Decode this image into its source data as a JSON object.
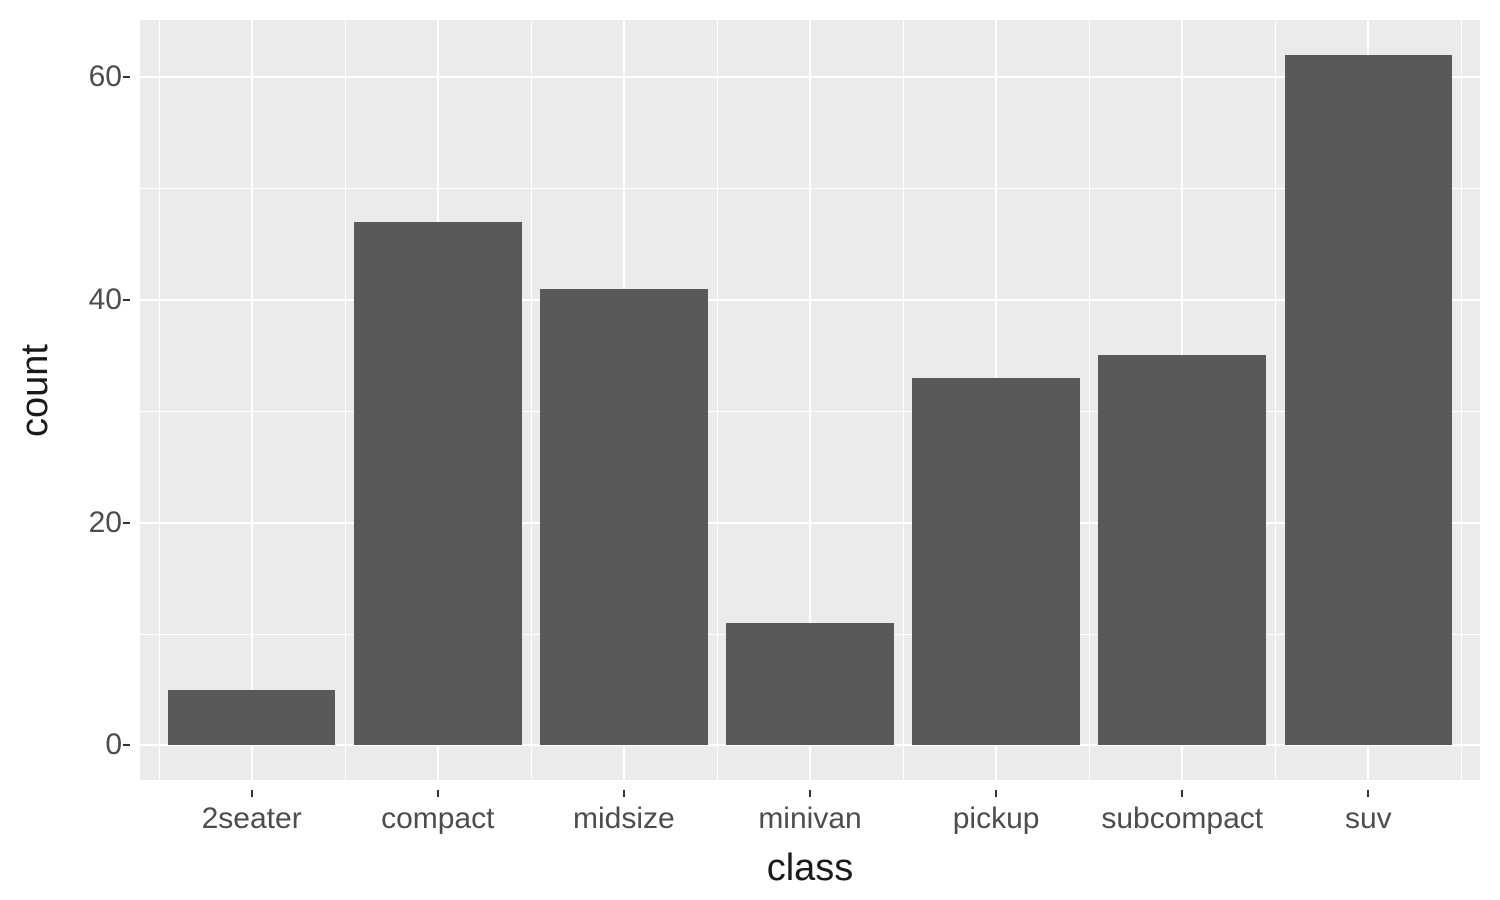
{
  "chart_data": {
    "type": "bar",
    "categories": [
      "2seater",
      "compact",
      "midsize",
      "minivan",
      "pickup",
      "subcompact",
      "suv"
    ],
    "values": [
      5,
      47,
      41,
      11,
      33,
      35,
      62
    ],
    "xlabel": "class",
    "ylabel": "count",
    "ylim": [
      -3.1,
      65.1
    ],
    "y_ticks": [
      0,
      20,
      40,
      60
    ],
    "y_minor_ticks": [
      10,
      30,
      50
    ],
    "colors": {
      "panel_bg": "#ebebeb",
      "grid": "#ffffff",
      "bar_fill": "#595959",
      "text": "#4d4d4d",
      "title_text": "#1a1a1a"
    }
  }
}
